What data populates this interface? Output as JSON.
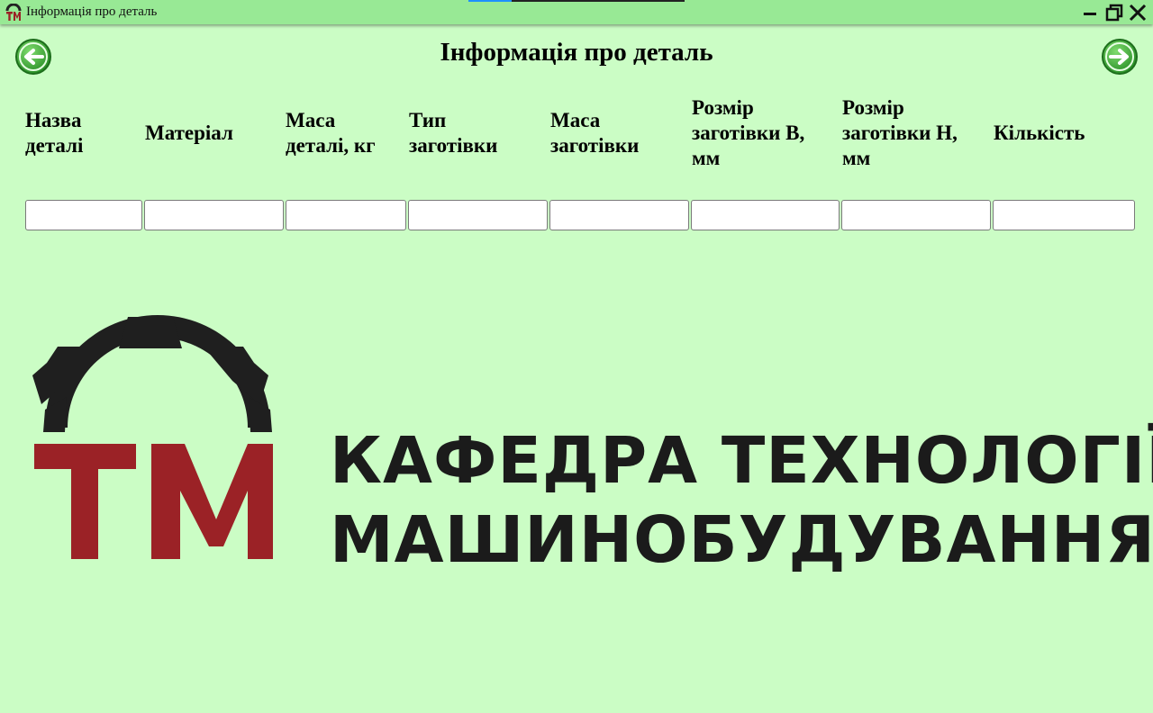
{
  "window": {
    "title": "Інформація про деталь"
  },
  "page": {
    "title": "Інформація про деталь"
  },
  "columns": [
    {
      "label": "Назва\nдеталі",
      "value": ""
    },
    {
      "label": "Матеріал",
      "value": ""
    },
    {
      "label": "Маса\nдеталі, кг",
      "value": ""
    },
    {
      "label": "Тип\nзаготівки",
      "value": ""
    },
    {
      "label": "Маса\nзаготівки",
      "value": ""
    },
    {
      "label": "Розмір\nзаготівки В,\nмм",
      "value": ""
    },
    {
      "label": "Розмір\nзаготівки Н,\nмм",
      "value": ""
    },
    {
      "label": "Кількість",
      "value": ""
    }
  ],
  "logo": {
    "letters": "ТМ",
    "line1": "КАФЕДРА ТЕХНОЛОГІЇ",
    "line2": "МАШИНОБУДУВАННЯ"
  },
  "icons": {
    "back": "arrow-left-circle-icon",
    "forward": "arrow-right-circle-icon",
    "minimize": "minimize-icon",
    "restore": "restore-icon",
    "close": "close-icon"
  },
  "colors": {
    "background": "#cbfdc5",
    "titlebar": "#98e995",
    "nav_button": "#3fae3a",
    "logo_gear": "#1f1f1f",
    "logo_letters": "#9b2226",
    "text": "#1b1b1b"
  }
}
